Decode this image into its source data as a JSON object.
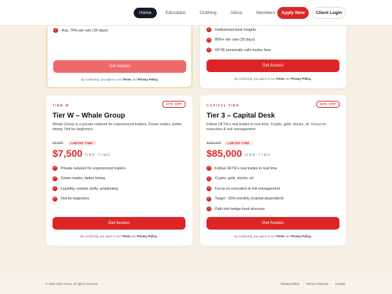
{
  "nav": {
    "items": [
      "Home",
      "Education",
      "Clothing",
      "About",
      "Members"
    ],
    "active_index": 0,
    "apply_label": "Apply Now",
    "client_label": "Client Login"
  },
  "top_cards": {
    "left": {
      "features": [
        "Avg. 74% win rate (30 days)"
      ],
      "cta": "Get Access",
      "legal_prefix": "By continuing, you agree to our",
      "terms": "Terms",
      "and": "and",
      "privacy": "Privacy Policy."
    },
    "right": {
      "features": [
        "Institutional-level insights",
        "80%+ win rate (30 days)",
        "OFYE personally calls trades here"
      ],
      "cta": "Get Access",
      "legal_prefix": "By continuing, you agree to our",
      "terms": "Terms",
      "and": "and",
      "privacy": "Privacy Policy."
    }
  },
  "tiers": [
    {
      "label": "TIER W",
      "badge": "17% OFF",
      "title": "Tier W – Whale Group",
      "description": "Whale Group is a private network for experienced traders. Fewer trades, better timing. Not for beginners.",
      "old_price": "$9,000",
      "limited": "LIMITED TIME",
      "price": "$7,500",
      "price_note": "ONE-TIME",
      "features": [
        "Private network for experienced traders",
        "Fewer trades, better timing",
        "Liquidity, volume shifts, positioning",
        "Not for beginners"
      ],
      "cta": "Get Access",
      "legal_prefix": "By continuing, you agree to our",
      "terms": "Terms",
      "and": "and",
      "privacy": "Privacy Policy."
    },
    {
      "label": "CAPITAL TIER",
      "badge": "15% OFF",
      "title": "Tier 3 – Capital Desk",
      "description": "Follow OFYE's real trades in real time. Crypto, gold, stocks, oil. Focus on execution & risk management.",
      "old_price": "$100,000",
      "limited": "LIMITED TIME",
      "price": "$85,000",
      "price_note": "ONE-TIME",
      "features": [
        "Follow OFYE's real trades in real time",
        "Crypto, gold, stocks, oil",
        "Focus on execution & risk management",
        "Target ~25% monthly (market-dependent)",
        "Path into hedge-fund structure"
      ],
      "cta": "Get Access",
      "legal_prefix": "By continuing, you agree to our",
      "terms": "Terms",
      "and": "and",
      "privacy": "Privacy Policy."
    }
  ],
  "footer": {
    "copyright": "© 2026 Ofye Group. All rights reserved.",
    "links": [
      "Privacy Policy",
      "Terms of Service",
      "Contact"
    ],
    "separator": "·"
  },
  "colors": {
    "accent": "#dc2626",
    "nav_active": "#141a29",
    "background": "#f6efe3"
  },
  "icons": {
    "feature_check": "check-circle-icon"
  }
}
